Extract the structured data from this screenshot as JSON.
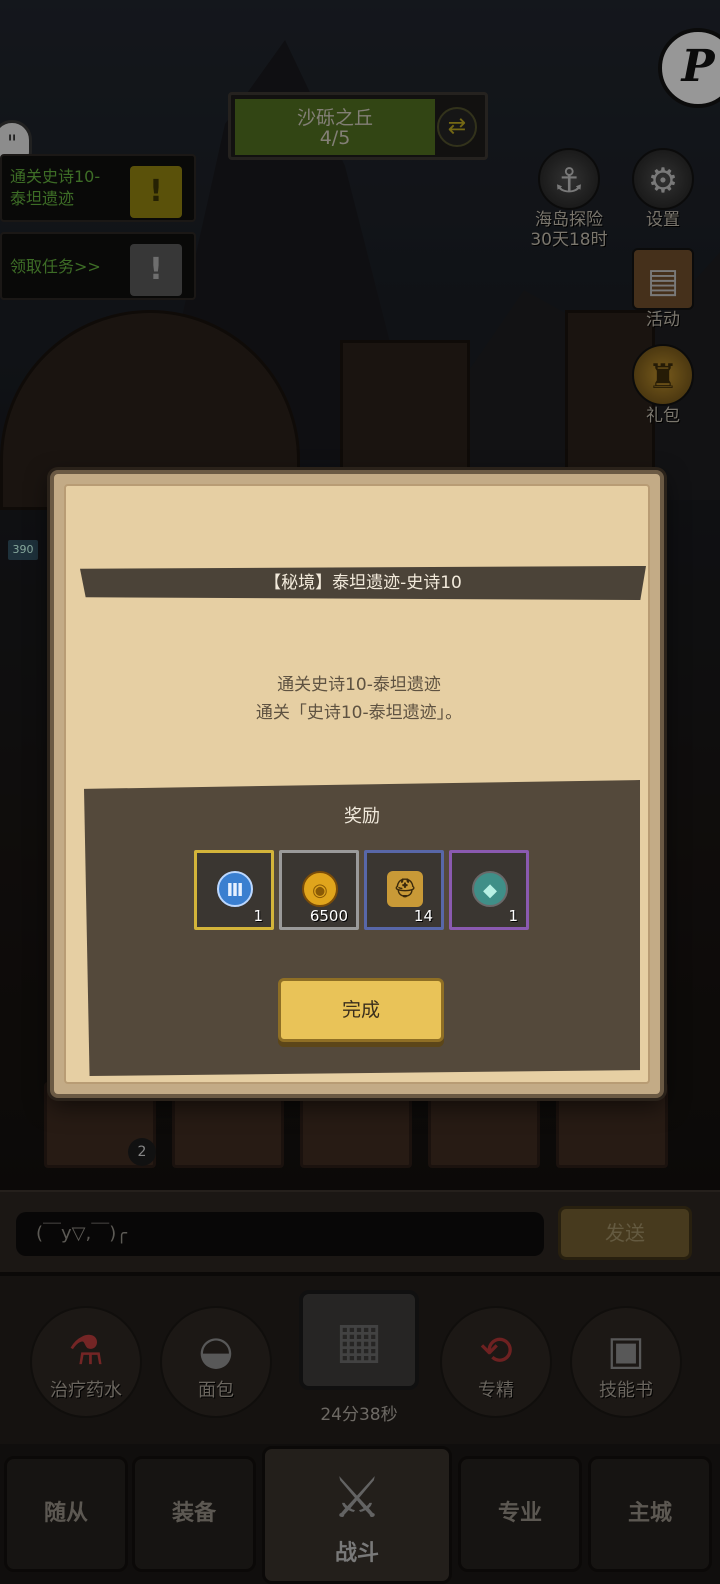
{
  "hud": {
    "stage_name": "沙砾之丘",
    "stage_progress": "4/5",
    "quest_tile_1": "通关史诗10-\n泰坦遗迹",
    "quest_tile_2": "领取任务>>",
    "level_tag": "390"
  },
  "right_menu": {
    "sea_explore": "海岛探险",
    "sea_explore_timer": "30天18时",
    "settings": "设置",
    "events": "活动",
    "gift": "礼包"
  },
  "modal": {
    "title": "【秘境】泰坦遗迹-史诗10",
    "mission_name": "通关史诗10-泰坦遗迹",
    "mission_desc": "通关「史诗10-泰坦遗迹」。",
    "reward_title": "奖励",
    "rewards": [
      {
        "icon": "roman-numeral-3-token-icon",
        "qty": "1",
        "border": "#d3b43a",
        "pic_bg": "#3a7fd0",
        "glyph": "Ⅲ"
      },
      {
        "icon": "gold-coin-icon",
        "qty": "6500",
        "border": "#9a9a9a",
        "pic_bg": "#e0a51c",
        "glyph": "◉"
      },
      {
        "icon": "helmet-icon",
        "qty": "14",
        "border": "#5867a8",
        "pic_bg": "#c99a37",
        "glyph": "⛑"
      },
      {
        "icon": "gem-ore-icon",
        "qty": "1",
        "border": "#8a5ab0",
        "pic_bg": "#3f8f88",
        "glyph": "◆"
      }
    ],
    "done_label": "完成"
  },
  "chat": {
    "input_value": "(￣y▽,￣)╭",
    "send_label": "发送"
  },
  "quick_items": {
    "potion": "治疗药水",
    "bread": "面包",
    "chest_timer": "24分38秒",
    "specialize": "专精",
    "skill_book": "技能书"
  },
  "card_badge": "2",
  "nav": {
    "followers": "随从",
    "equipment": "装备",
    "battle": "战斗",
    "profession": "专业",
    "main_city": "主城"
  },
  "colors": {
    "modal_bg": "#e6cfa3",
    "title_bar": "#4b4338",
    "done_button": "#e9c358"
  }
}
